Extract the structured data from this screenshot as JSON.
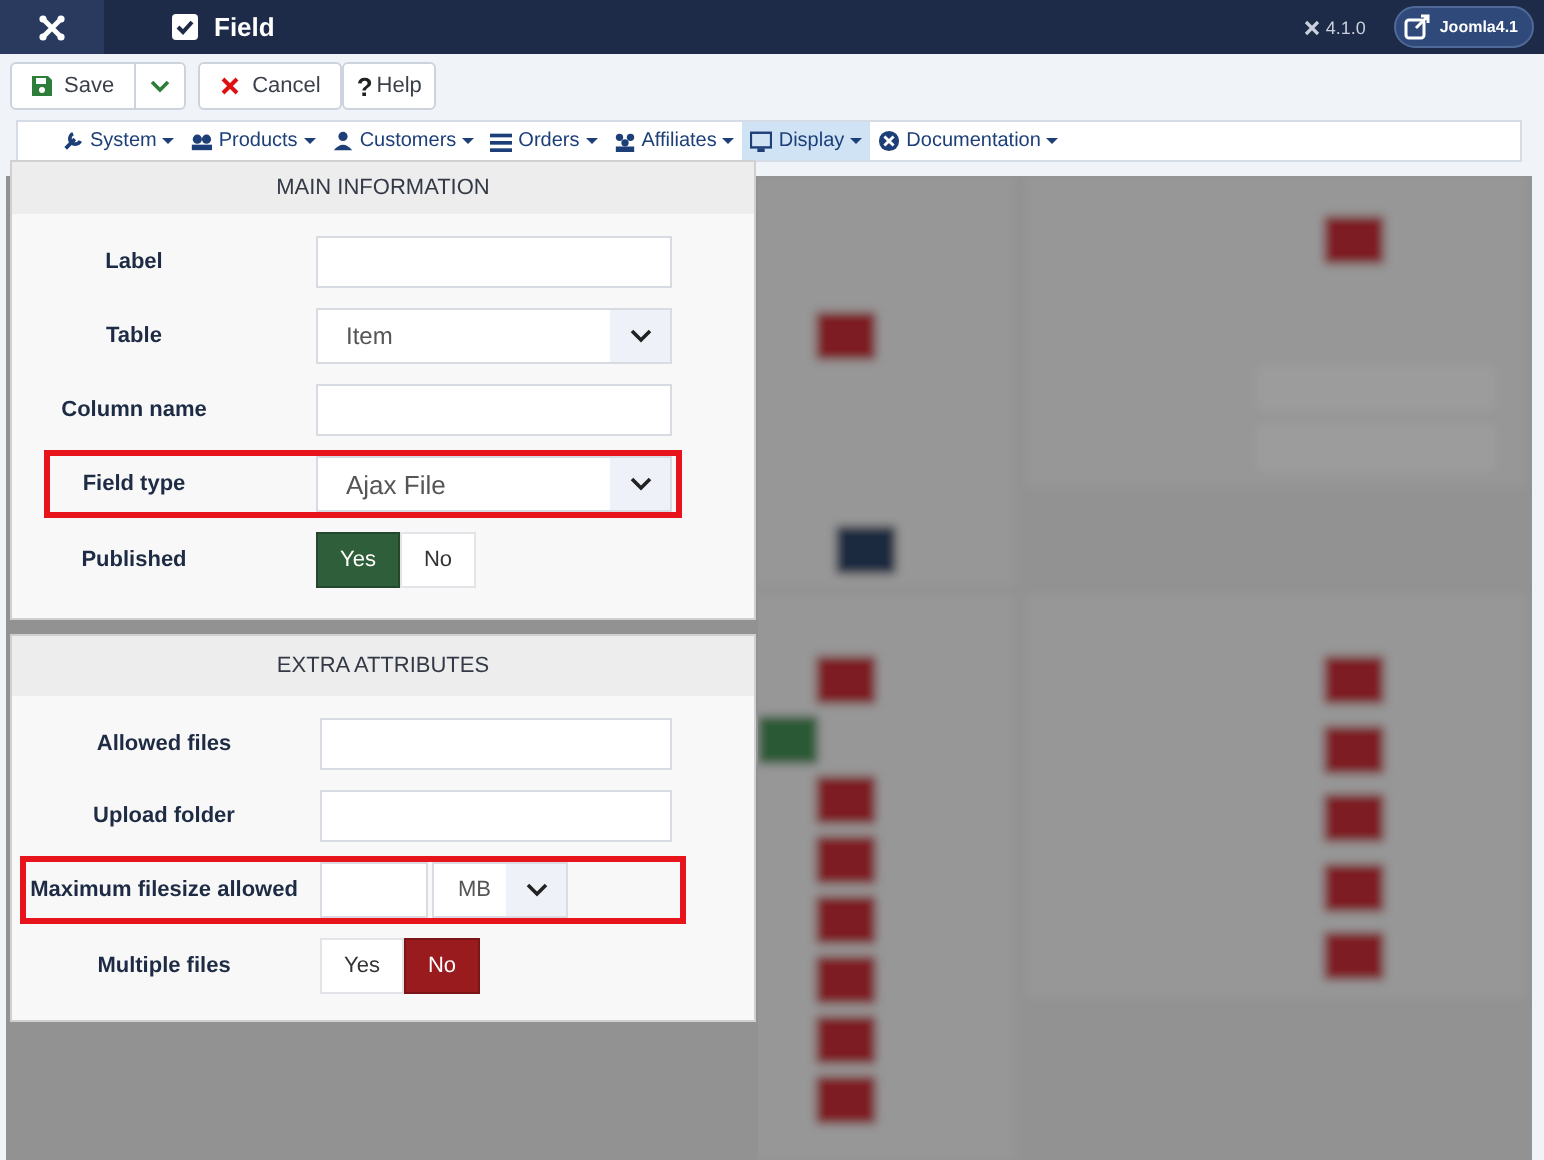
{
  "header": {
    "title": "Field",
    "version": "4.1.0",
    "site_button": "Joomla4.1"
  },
  "toolbar": {
    "buttons": [
      {
        "kind": "save",
        "label": "Save"
      },
      {
        "kind": "caret"
      },
      {
        "kind": "cancel",
        "label": "Cancel"
      },
      {
        "kind": "help",
        "icon_text": "?",
        "label": "Help"
      }
    ]
  },
  "menu": {
    "items": [
      {
        "label": "System",
        "selected": false
      },
      {
        "label": "Products",
        "selected": false
      },
      {
        "label": "Customers",
        "selected": false
      },
      {
        "label": "Orders",
        "selected": false
      },
      {
        "label": "Affiliates",
        "selected": false
      },
      {
        "label": "Display",
        "selected": true
      },
      {
        "label": "Documentation",
        "selected": false
      }
    ]
  },
  "panels": [
    {
      "title": "MAIN INFORMATION",
      "fields": [
        {
          "kind": "text",
          "label": "Label",
          "highlighted": false
        },
        {
          "kind": "select",
          "label": "Table",
          "value": "Item",
          "highlighted": false
        },
        {
          "kind": "text",
          "label": "Column name",
          "highlighted": false
        },
        {
          "kind": "select",
          "label": "Field type",
          "value": "Ajax File",
          "highlighted": true
        },
        {
          "kind": "toggle",
          "label": "Published",
          "highlighted": false,
          "options": [
            {
              "label": "Yes",
              "selected": true
            },
            {
              "label": "No",
              "selected": false
            }
          ]
        }
      ]
    },
    {
      "title": "EXTRA ATTRIBUTES",
      "fields": [
        {
          "kind": "text",
          "label": "Allowed files",
          "highlighted": false
        },
        {
          "kind": "text",
          "label": "Upload folder",
          "highlighted": false
        },
        {
          "kind": "size",
          "label": "Maximum filesize allowed",
          "unit": "MB",
          "highlighted": true
        },
        {
          "kind": "toggle",
          "label": "Multiple files",
          "highlighted": false,
          "options": [
            {
              "label": "Yes",
              "selected": false
            },
            {
              "label": "No",
              "selected": true
            }
          ]
        }
      ]
    }
  ]
}
